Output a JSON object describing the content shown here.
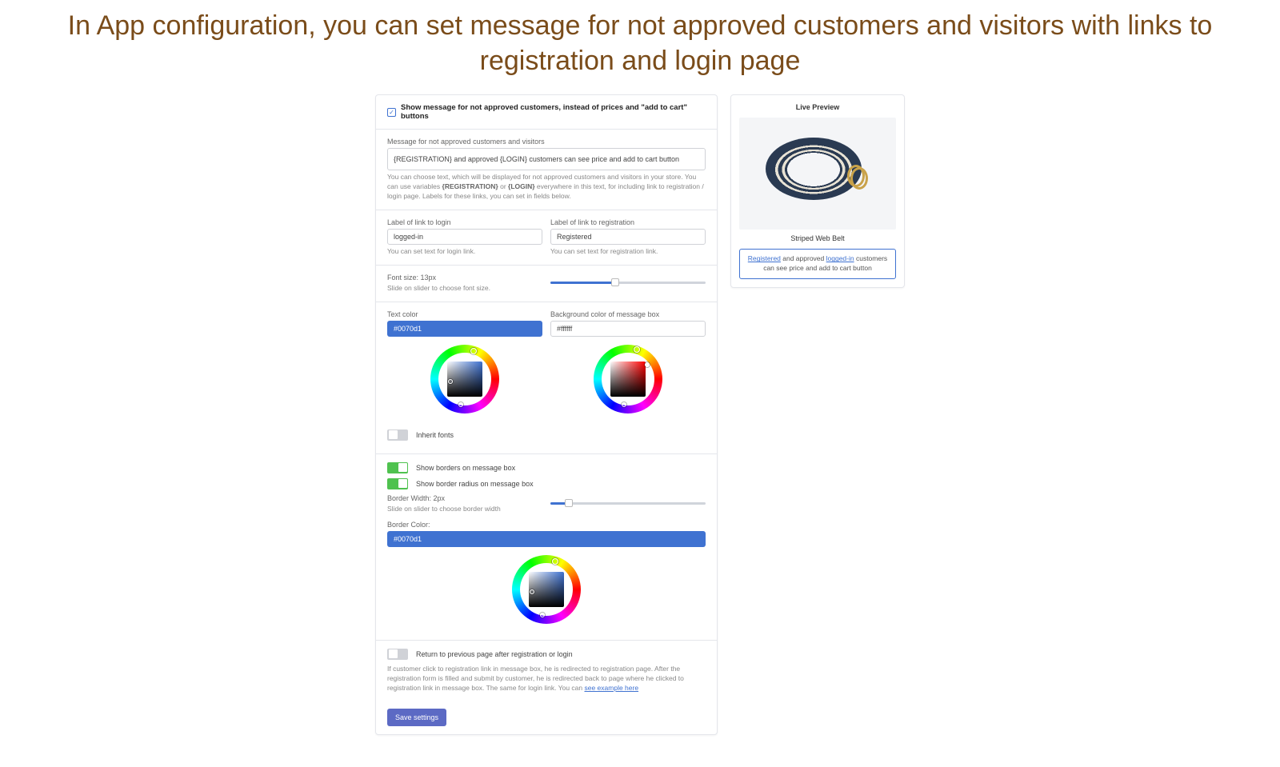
{
  "pageTitle": "In App configuration, you can set message for not approved customers and visitors with links to registration and login page",
  "showMsg": {
    "label": "Show message for not approved customers, instead of prices and \"add to cart\" buttons"
  },
  "msgField": {
    "label": "Message for not approved customers and visitors",
    "value": "{REGISTRATION} and approved {LOGIN} customers can see price and add to cart button",
    "help1": "You can choose text, which will be displayed for not approved customers and visitors in your store. You can use variables ",
    "help2": " or ",
    "help3": " everywhere in this text, for including link to registration / login page. Labels for these links, you can set in fields below.",
    "var1": "{REGISTRATION}",
    "var2": "{LOGIN}"
  },
  "loginLabel": {
    "label": "Label of link to login",
    "value": "logged-in",
    "help": "You can set text for login link."
  },
  "regLabel": {
    "label": "Label of link to registration",
    "value": "Registered",
    "help": "You can set text for registration link."
  },
  "fontSize": {
    "label": "Font size: 13px",
    "help": "Slide on slider to choose font size."
  },
  "textColor": {
    "label": "Text color",
    "value": "#0070d1"
  },
  "bgColor": {
    "label": "Background color of message box",
    "value": "#ffffff"
  },
  "inheritFonts": {
    "label": "Inherit fonts"
  },
  "showBorders": {
    "label": "Show borders on message box"
  },
  "showRadius": {
    "label": "Show border radius on message box"
  },
  "borderWidth": {
    "label": "Border Width: 2px",
    "help": "Slide on slider to choose border width"
  },
  "borderColor": {
    "label": "Border Color:",
    "value": "#0070d1"
  },
  "returnPrev": {
    "label": "Return to previous page after registration or login",
    "help": "If customer click to registration link in message box, he is redirected to registration page. After the registration form is filled and submit by customer, he is redirected back to page where he clicked to registration link in message box. The same for login link. You can ",
    "linkText": "see example here"
  },
  "saveBtn": "Save settings",
  "preview": {
    "title": "Live Preview",
    "productName": "Striped Web Belt",
    "msgReg": "Registered",
    "msgMid": " and approved ",
    "msgLogin": "logged-in",
    "msgEnd": " customers can see price and add to cart button"
  }
}
